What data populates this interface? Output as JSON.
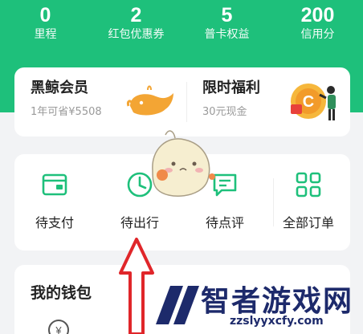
{
  "stats": [
    {
      "value": "0",
      "label": "里程"
    },
    {
      "value": "2",
      "label": "红包优惠券"
    },
    {
      "value": "5",
      "label": "普卡权益"
    },
    {
      "value": "200",
      "label": "信用分"
    }
  ],
  "promo": {
    "left_title": "黑鲸会员",
    "left_sub": "1年可省¥5508",
    "right_title": "限时福利",
    "right_sub": "30元现金"
  },
  "orders": [
    {
      "label": "待支付",
      "icon": "wallet-icon"
    },
    {
      "label": "待出行",
      "icon": "clock-icon"
    },
    {
      "label": "待点评",
      "icon": "comment-icon"
    },
    {
      "label": "全部订单",
      "icon": "grid-icon"
    }
  ],
  "wallet": {
    "title": "我的钱包"
  },
  "watermark": {
    "title": "智者游戏网",
    "url": "zzslyyxcfy.com"
  },
  "colors": {
    "brand": "#1ec07b",
    "text": "#222222",
    "sub": "#9a9a9a",
    "arrow": "#e0262a"
  }
}
